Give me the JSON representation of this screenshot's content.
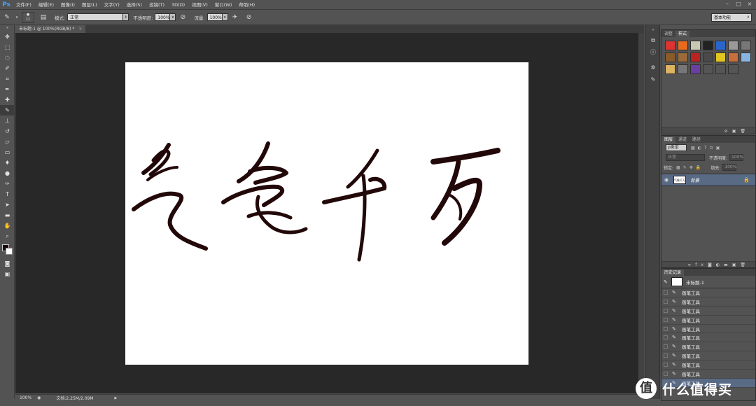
{
  "app": {
    "logo": "Ps"
  },
  "menu": [
    "文件(F)",
    "编辑(E)",
    "图像(I)",
    "图层(L)",
    "文字(Y)",
    "选择(S)",
    "滤镜(T)",
    "3D(D)",
    "视图(V)",
    "窗口(W)",
    "帮助(H)"
  ],
  "window_controls": {
    "minimize": "–",
    "restore": "□",
    "close": "×"
  },
  "options": {
    "brush_size": "11",
    "mode_label": "模式:",
    "mode_value": "正常",
    "opacity_label": "不透明度:",
    "opacity_value": "100%",
    "flow_label": "流量:",
    "flow_value": "100%",
    "workspace": "基本功能"
  },
  "document": {
    "tab_title": "未标题-1 @ 100%(RGB/8) *",
    "tab_close": "×"
  },
  "status": {
    "zoom": "100%",
    "doc_size": "文档:2.25M/2.09M",
    "arrow": "▶"
  },
  "styles_panel": {
    "tabs": [
      "调整",
      "样式"
    ],
    "swatches": [
      "#d33",
      "#e86a1c",
      "#c8c8b4",
      "#222",
      "#2a66c9",
      "#999",
      "#777",
      "#8a5b2a",
      "#9a6a3a",
      "#b22",
      "#4a4a4a",
      "#e3c520",
      "#c86e3c",
      "#8ab4e0",
      "#dbb460",
      "#777",
      "#6b3fa0",
      "#555",
      "#555",
      "#555"
    ]
  },
  "layers_panel": {
    "tabs": [
      "图层",
      "通道",
      "路径"
    ],
    "kind_label": "ρ类型",
    "blend_mode": "正常",
    "opacity_label": "不透明度:",
    "opacity_value": "100%",
    "lock_label": "锁定:",
    "fill_label": "填充:",
    "fill_value": "100%",
    "layer_name": "背景",
    "layer_thumb_text": "气象千万"
  },
  "history_panel": {
    "title": "历史记录",
    "snapshot_name": "未标题-1",
    "steps": [
      "画笔工具",
      "画笔工具",
      "画笔工具",
      "画笔工具",
      "画笔工具",
      "画笔工具",
      "画笔工具",
      "画笔工具",
      "画笔工具",
      "画笔工具",
      "画笔工具"
    ]
  },
  "watermark": {
    "icon_text": "值",
    "text": "什么值得买"
  }
}
